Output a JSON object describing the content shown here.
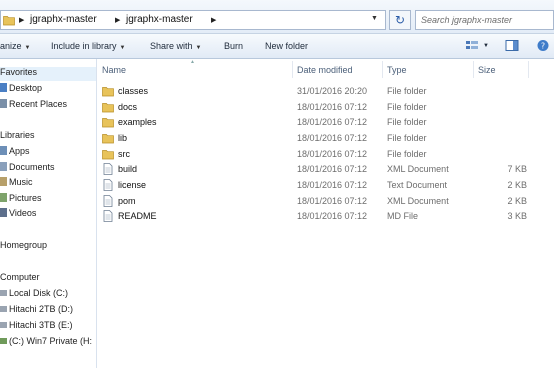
{
  "address": {
    "crumbs": [
      "jgraphx-master",
      "jgraphx-master"
    ],
    "search_placeholder": "Search jgraphx-master"
  },
  "toolbar": {
    "organize": "anize",
    "include_in_library": "Include in library",
    "share_with": "Share with",
    "burn": "Burn",
    "new_folder": "New folder"
  },
  "nav": {
    "favorites": "Favorites",
    "desktop": "Desktop",
    "recent_places": "Recent Places",
    "libraries": "Libraries",
    "apps": "Apps",
    "documents": "Documents",
    "music": "Music",
    "pictures": "Pictures",
    "videos": "Videos",
    "homegroup": "Homegroup",
    "computer": "Computer",
    "local_disk": "Local Disk (C:)",
    "hitachi_d": "Hitachi 2TB (D:)",
    "hitachi_e": "Hitachi 3TB (E:)",
    "win7_private": "(C:) Win7 Private (H:"
  },
  "columns": {
    "name": "Name",
    "date_modified": "Date modified",
    "type": "Type",
    "size": "Size"
  },
  "files": [
    {
      "name": "classes",
      "date": "31/01/2016 20:20",
      "type": "File folder",
      "size": "",
      "icon": "folder-icon"
    },
    {
      "name": "docs",
      "date": "18/01/2016 07:12",
      "type": "File folder",
      "size": "",
      "icon": "folder-icon"
    },
    {
      "name": "examples",
      "date": "18/01/2016 07:12",
      "type": "File folder",
      "size": "",
      "icon": "folder-icon"
    },
    {
      "name": "lib",
      "date": "18/01/2016 07:12",
      "type": "File folder",
      "size": "",
      "icon": "folder-icon"
    },
    {
      "name": "src",
      "date": "18/01/2016 07:12",
      "type": "File folder",
      "size": "",
      "icon": "folder-icon"
    },
    {
      "name": "build",
      "date": "18/01/2016 07:12",
      "type": "XML Document",
      "size": "7 KB",
      "icon": "document-icon"
    },
    {
      "name": "license",
      "date": "18/01/2016 07:12",
      "type": "Text Document",
      "size": "2 KB",
      "icon": "document-icon"
    },
    {
      "name": "pom",
      "date": "18/01/2016 07:12",
      "type": "XML Document",
      "size": "2 KB",
      "icon": "document-icon"
    },
    {
      "name": "README",
      "date": "18/01/2016 07:12",
      "type": "MD File",
      "size": "3 KB",
      "icon": "document-icon"
    }
  ]
}
